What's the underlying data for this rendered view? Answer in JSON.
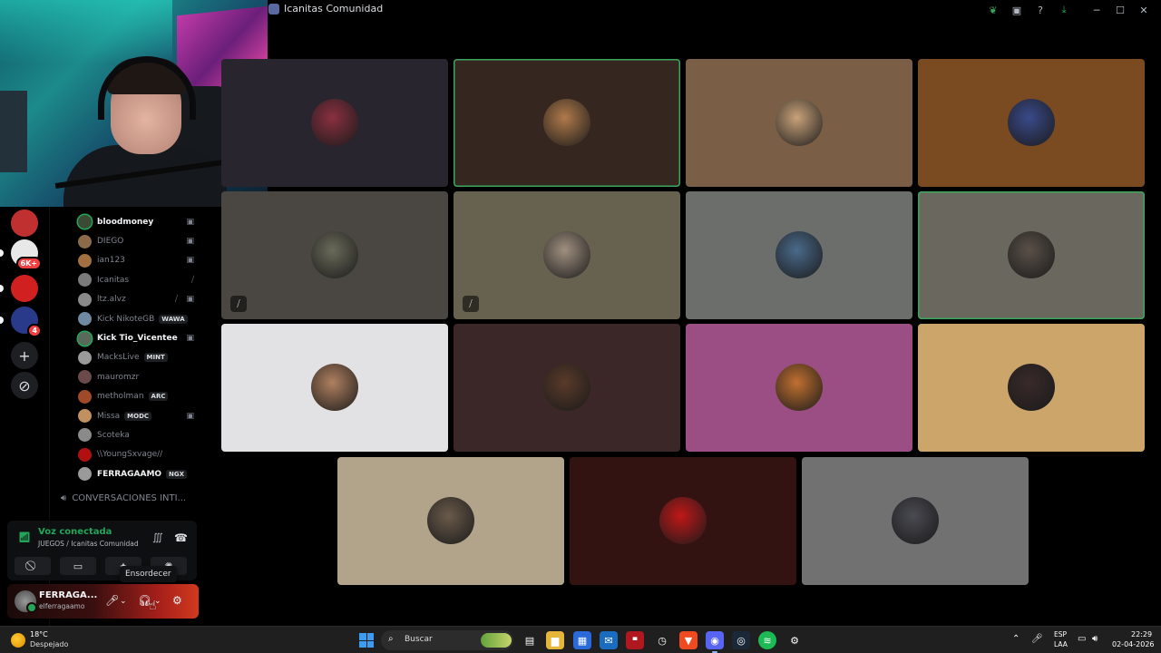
{
  "window": {
    "title": "Icanitas Comunidad"
  },
  "members": [
    {
      "name": "bloodmoney",
      "active": true,
      "speaking": true,
      "color": "#3b4a33",
      "icons": [
        "stream"
      ]
    },
    {
      "name": "DIEGO",
      "active": false,
      "speaking": false,
      "color": "#8a6a4a",
      "icons": [
        "stream"
      ]
    },
    {
      "name": "ian123",
      "active": false,
      "speaking": false,
      "color": "#a07040",
      "icons": [
        "stream"
      ]
    },
    {
      "name": "Icanitas",
      "active": false,
      "speaking": false,
      "color": "#7a7a7a",
      "icons": [
        "deafen"
      ]
    },
    {
      "name": "ltz.alvz",
      "active": false,
      "speaking": false,
      "color": "#8a8a8a",
      "icons": [
        "deafen",
        "stream"
      ]
    },
    {
      "name": "Kick NikoteGB",
      "active": false,
      "speaking": false,
      "color": "#6f8aa0",
      "tag": "WAWA",
      "icons": []
    },
    {
      "name": "Kick Tio_Vicentee",
      "active": true,
      "speaking": true,
      "color": "#5a6a5a",
      "icons": [
        "stream"
      ]
    },
    {
      "name": "MacksLive",
      "active": false,
      "speaking": false,
      "color": "#9a9a9a",
      "tag": "MINT",
      "icons": []
    },
    {
      "name": "mauromzr",
      "active": false,
      "speaking": false,
      "color": "#6a4a4a",
      "icons": []
    },
    {
      "name": "metholman",
      "active": false,
      "speaking": false,
      "color": "#a04a2a",
      "tag": "ARC",
      "icons": []
    },
    {
      "name": "Missa",
      "active": false,
      "speaking": false,
      "color": "#c09060",
      "tag": "MODC",
      "icons": [
        "stream"
      ]
    },
    {
      "name": "Scoteka",
      "active": false,
      "speaking": false,
      "color": "#8a8a8a",
      "icons": []
    },
    {
      "name": "\\\\YoungSxvage//",
      "active": false,
      "speaking": false,
      "color": "#b01010",
      "icons": []
    },
    {
      "name": "FERRAGAAMO",
      "active": true,
      "speaking": false,
      "color": "#9a9a9a",
      "tag": "NGX",
      "icons": []
    }
  ],
  "channel": {
    "label": "CONVERSACIONES INTI..."
  },
  "voice": {
    "status": "Voz conectada",
    "subtitle": "JUEGOS / Icanitas Comunidad",
    "tooltip": "Ensordecer"
  },
  "user": {
    "display_name": "FERRAGA...",
    "handle": "elferragaamo"
  },
  "tiles": [
    {
      "bg": "#28252f",
      "avatar": "#8a3040",
      "speaking": false,
      "muted": false
    },
    {
      "bg": "#35261f",
      "avatar": "#b07a4a",
      "speaking": true,
      "muted": false
    },
    {
      "bg": "#7a5e45",
      "avatar": "#c9a27a",
      "speaking": false,
      "muted": false
    },
    {
      "bg": "#7a4a20",
      "avatar": "#3a4a8a",
      "speaking": false,
      "muted": false
    },
    {
      "bg": "#4a4742",
      "avatar": "#6a6a5a",
      "speaking": false,
      "muted": true
    },
    {
      "bg": "#67624f",
      "avatar": "#a09080",
      "speaking": false,
      "muted": true
    },
    {
      "bg": "#6b6e6a",
      "avatar": "#4a6a8a",
      "speaking": false,
      "muted": false
    },
    {
      "bg": "#6a675f",
      "avatar": "#5a5048",
      "speaking": true,
      "muted": false
    },
    {
      "bg": "#e2e1e3",
      "avatar": "#b08060",
      "speaking": false,
      "muted": false
    },
    {
      "bg": "#3b2727",
      "avatar": "#5a3a2a",
      "speaking": false,
      "muted": false
    },
    {
      "bg": "#9a4e83",
      "avatar": "#c07030",
      "speaking": false,
      "muted": false
    },
    {
      "bg": "#cba56a",
      "avatar": "#3a2a2a",
      "speaking": false,
      "muted": false
    },
    {
      "bg": "#b1a48a",
      "avatar": "#6a5a4a",
      "speaking": false,
      "muted": false
    },
    {
      "bg": "#321312",
      "avatar": "#c01818",
      "speaking": false,
      "muted": false
    },
    {
      "bg": "#707170",
      "avatar": "#4a4a52",
      "speaking": false,
      "muted": false
    }
  ],
  "servers": [
    {
      "color": "#c03030",
      "pill": false,
      "badge": ""
    },
    {
      "color": "#e8e8e8",
      "pill": true,
      "badge": "6K+"
    },
    {
      "color": "#d02020",
      "pill": true,
      "badge": ""
    },
    {
      "color": "#2a3a8a",
      "pill": true,
      "badge": "4"
    }
  ],
  "taskbar": {
    "weather_temp": "18°C",
    "weather_desc": "Despejado",
    "search_placeholder": "Buscar",
    "lang": "ESP",
    "lang2": "LAA",
    "time": "22:29",
    "date": "02-04-2026"
  },
  "icons": {
    "stream": "📷",
    "deafen": "🎧",
    "muted": "🎤"
  },
  "colors": {
    "accent_green": "#23a55a",
    "background": "#000000"
  }
}
